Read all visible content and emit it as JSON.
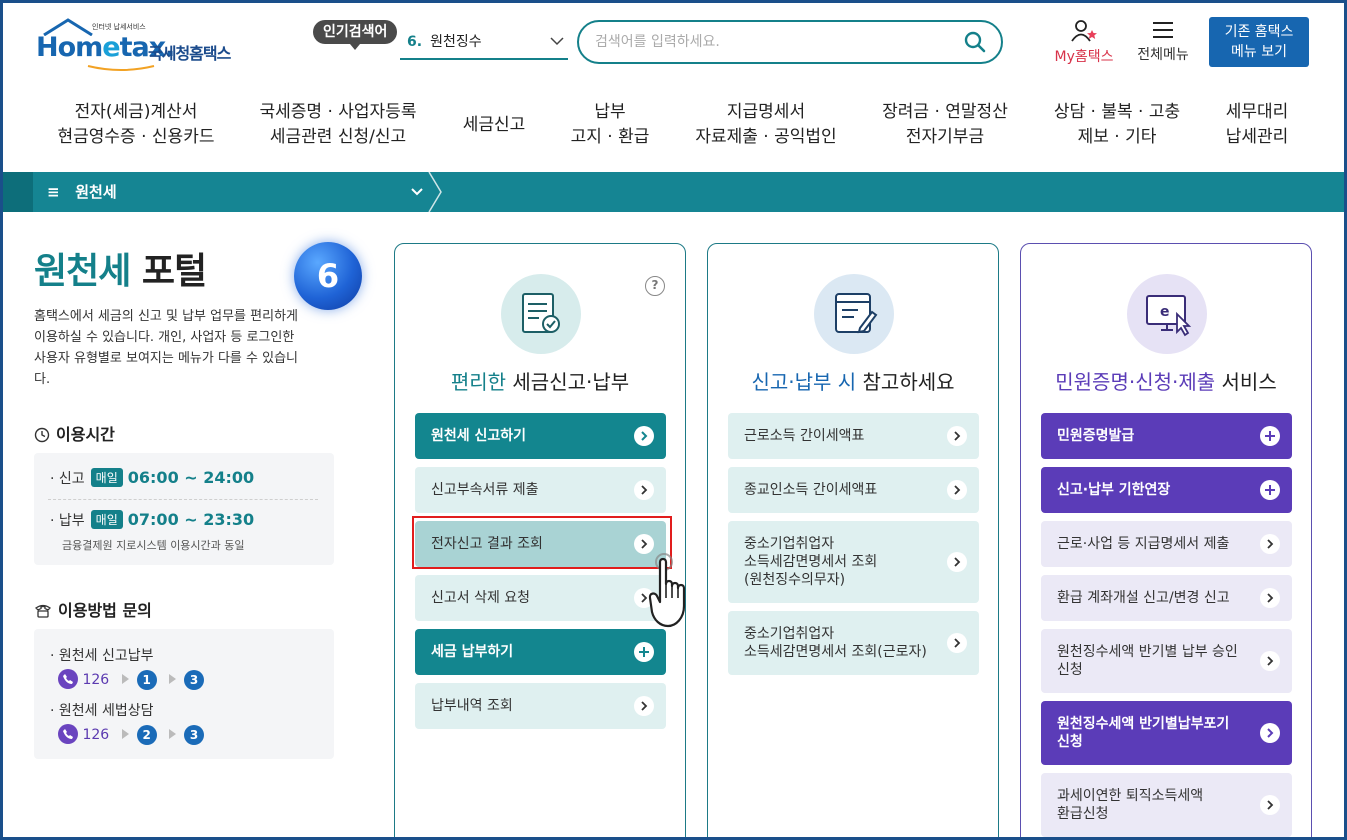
{
  "header": {
    "logo_tiny": "인터넷 납세서비스",
    "logo_brand_a": "Hom",
    "logo_brand_e": "e",
    "logo_brand_b": "tax.",
    "logo_kr": "국세청홈택스",
    "popular_label": "인기검색어",
    "popular_num": "6.",
    "popular_term": "원천징수",
    "search_placeholder": "검색어를 입력하세요.",
    "myhometax": "My홈택스",
    "all_menu": "전체메뉴",
    "old_menu_line1": "기존 홈택스",
    "old_menu_line2": "메뉴 보기"
  },
  "gnb": [
    {
      "l1": "전자(세금)계산서",
      "l2": "현금영수증 · 신용카드"
    },
    {
      "l1": "국세증명 · 사업자등록",
      "l2": "세금관련 신청/신고"
    },
    {
      "l1": "세금신고",
      "l2": ""
    },
    {
      "l1": "납부",
      "l2": "고지 · 환급"
    },
    {
      "l1": "지급명세서",
      "l2": "자료제출 · 공익법인"
    },
    {
      "l1": "장려금 · 연말정산",
      "l2": "전자기부금"
    },
    {
      "l1": "상담 · 불복 · 고충",
      "l2": "제보 · 기타"
    },
    {
      "l1": "세무대리",
      "l2": "납세관리"
    }
  ],
  "breadcrumb": {
    "menu_icon": "≡",
    "label": "원천세"
  },
  "portal": {
    "title_hl": "원천세",
    "title_rest": " 포털",
    "step_badge": "6",
    "desc": "홈택스에서 세금의 신고 및 납부 업무를 편리하게 이용하실 수 있습니다. 개인, 사업자 등 로그인한 사용자 유형별로 보여지는 메뉴가 다를 수 있습니다.",
    "hours_title": "이용시간",
    "hours": [
      {
        "name": "· 신고",
        "tag": "매일",
        "time": "06:00 ~ 24:00"
      },
      {
        "name": "· 납부",
        "tag": "매일",
        "time": "07:00 ~ 23:30"
      }
    ],
    "hours_note": "금융결제원 지로시스템 이용시간과 동일",
    "contact_title": "이용방법 문의",
    "contacts": [
      {
        "name": "· 원천세 신고납부",
        "phone": "126",
        "steps": [
          "1",
          "3"
        ]
      },
      {
        "name": "· 원천세 세법상담",
        "phone": "126",
        "steps": [
          "2",
          "3"
        ]
      }
    ]
  },
  "cards": [
    {
      "title_hl": "편리한",
      "title_rest": " 세금신고·납부",
      "help": "?",
      "items": [
        {
          "label": "원천세 신고하기",
          "style": "teal primary"
        },
        {
          "label": "신고부속서류 제출",
          "style": "light"
        },
        {
          "label": "전자신고 결과 조회",
          "style": "hover"
        },
        {
          "label": "신고서 삭제 요청",
          "style": "light"
        },
        {
          "label": "세금 납부하기",
          "style": "teal primary"
        },
        {
          "label": "납부내역 조회",
          "style": "light"
        }
      ]
    },
    {
      "title_hl": "신고·납부 시",
      "title_rest": " 참고하세요",
      "items": [
        {
          "label": "근로소득 간이세액표",
          "style": "light"
        },
        {
          "label": "종교인소득 간이세액표",
          "style": "light"
        },
        {
          "label": "중소기업취업자\n소득세감면명세서 조회\n(원천징수의무자)",
          "style": "light"
        },
        {
          "label": "중소기업취업자\n소득세감면명세서 조회(근로자)",
          "style": "light"
        }
      ]
    },
    {
      "title_hl": "민원증명·신청·제출",
      "title_rest": " 서비스",
      "items": [
        {
          "label": "민원증명발급",
          "style": "purple primary"
        },
        {
          "label": "신고·납부 기한연장",
          "style": "purple primary"
        },
        {
          "label": "근로·사업 등 지급명세서 제출",
          "style": "plight"
        },
        {
          "label": "환급 계좌개설 신고/변경 신고",
          "style": "plight"
        },
        {
          "label": "원천징수세액 반기별 납부 승인\n신청",
          "style": "plight"
        },
        {
          "label": "원천징수세액 반기별납부포기\n신청",
          "style": "purple primary"
        },
        {
          "label": "과세이연한 퇴직소득세액\n환급신청",
          "style": "plight"
        }
      ]
    }
  ],
  "colors": {
    "teal": "#13868f",
    "purple": "#5b3cb8",
    "blue": "#1766b0",
    "highlight": "#e11d1d"
  }
}
